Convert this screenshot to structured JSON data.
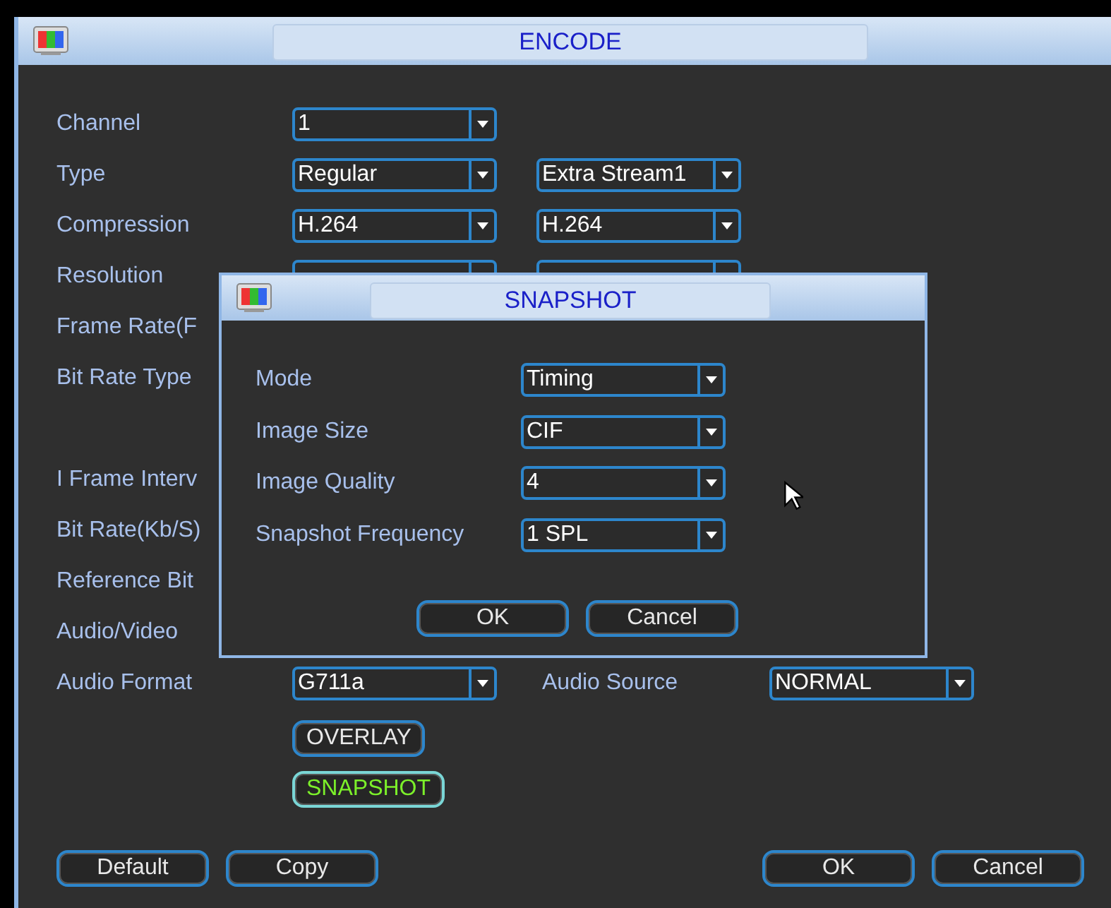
{
  "window": {
    "title": "ENCODE"
  },
  "rows": [
    {
      "label": "Channel",
      "fields": [
        {
          "kind": "select",
          "value": "1"
        }
      ]
    },
    {
      "label": "Type",
      "fields": [
        {
          "kind": "select",
          "value": "Regular"
        },
        {
          "kind": "select",
          "value": "Extra Stream1"
        }
      ]
    },
    {
      "label": "Compression",
      "fields": [
        {
          "kind": "select",
          "value": "H.264"
        },
        {
          "kind": "select",
          "value": "H.264"
        }
      ]
    },
    {
      "label": "Resolution",
      "fields": [
        {
          "kind": "select"
        },
        {
          "kind": "select"
        }
      ]
    },
    {
      "label": "Frame Rate(F",
      "fields": []
    },
    {
      "label": "Bit Rate Type",
      "fields": []
    },
    {
      "label": "I Frame Interv",
      "fields": []
    },
    {
      "label": "Bit Rate(Kb/S)",
      "fields": []
    },
    {
      "label": "Reference Bit",
      "fields": []
    },
    {
      "label": "Audio/Video",
      "fields": []
    },
    {
      "label": "Audio Format",
      "fields": [
        {
          "kind": "select",
          "value": "G711a"
        },
        {
          "kind": "label",
          "text": "Audio Source"
        },
        {
          "kind": "select",
          "value": "NORMAL"
        }
      ]
    }
  ],
  "option_buttons": [
    {
      "label": "OVERLAY",
      "selected": false
    },
    {
      "label": "SNAPSHOT",
      "selected": true
    }
  ],
  "left_buttons": [
    "Default",
    "Copy"
  ],
  "right_buttons": [
    "OK",
    "Cancel"
  ],
  "dialog": {
    "title": "SNAPSHOT",
    "rows": [
      {
        "label": "Mode",
        "value": "Timing"
      },
      {
        "label": "Image Size",
        "value": "CIF"
      },
      {
        "label": "Image Quality",
        "value": "4"
      },
      {
        "label": "Snapshot Frequency",
        "value": "1 SPL"
      }
    ],
    "buttons": [
      "OK",
      "Cancel"
    ]
  }
}
